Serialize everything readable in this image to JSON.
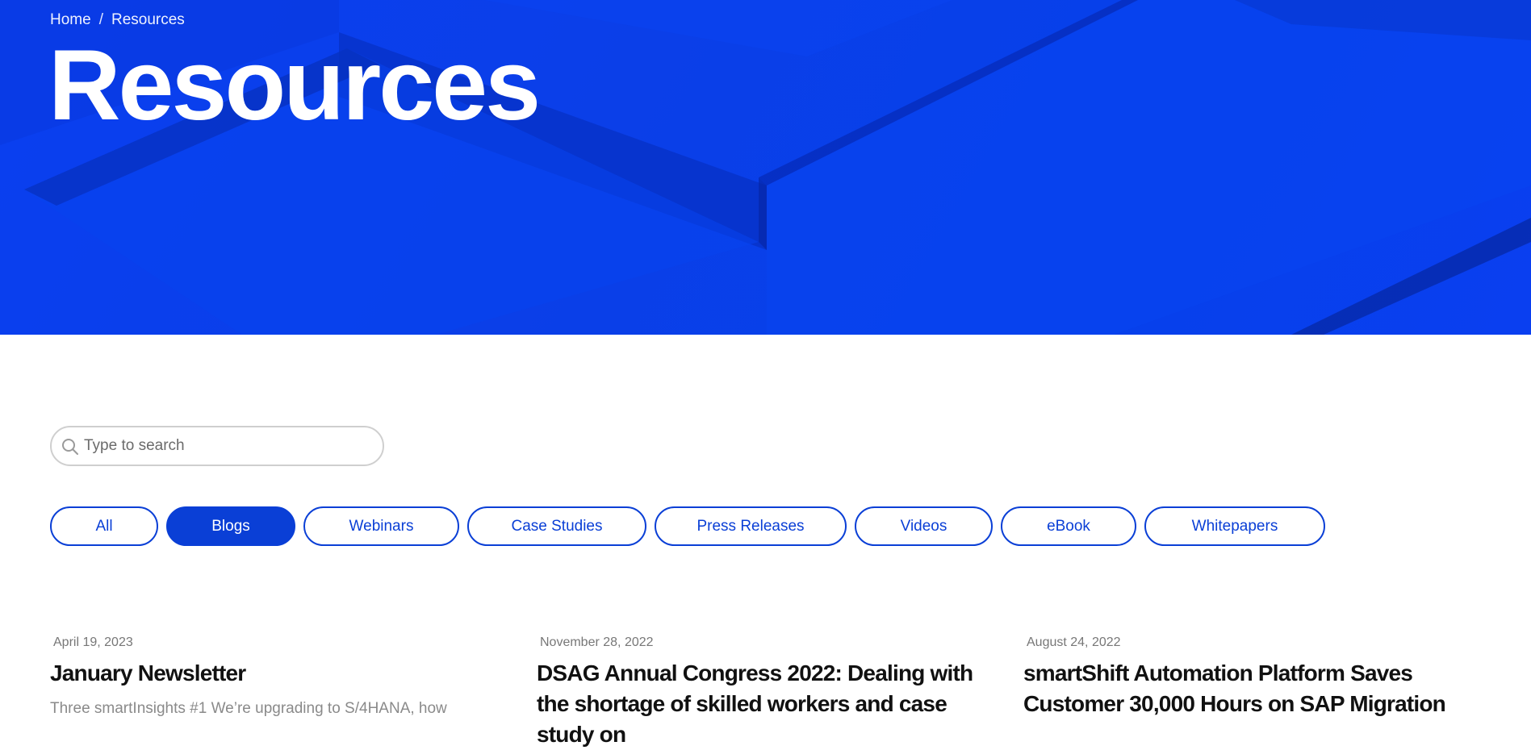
{
  "breadcrumb": {
    "home": "Home",
    "separator": "/",
    "current": "Resources"
  },
  "hero": {
    "title": "Resources",
    "color": "#0a3ff0"
  },
  "search": {
    "placeholder": "Type to search",
    "value": ""
  },
  "filters": [
    {
      "label": "All",
      "active": false
    },
    {
      "label": "Blogs",
      "active": true
    },
    {
      "label": "Webinars",
      "active": false
    },
    {
      "label": "Case Studies",
      "active": false
    },
    {
      "label": "Press Releases",
      "active": false
    },
    {
      "label": "Videos",
      "active": false
    },
    {
      "label": "eBook",
      "active": false
    },
    {
      "label": "Whitepapers",
      "active": false
    }
  ],
  "accent": "#0a3fd6",
  "posts": [
    {
      "date": "April 19, 2023",
      "title": "January Newsletter",
      "excerpt": "Three smartInsights #1 We’re upgrading to S/4HANA, how"
    },
    {
      "date": "November 28, 2022",
      "title": "DSAG Annual Congress 2022: Dealing with the shortage of skilled workers and case study on",
      "excerpt": ""
    },
    {
      "date": "August 24, 2022",
      "title": "smartShift Automation Platform Saves Customer 30,000 Hours on SAP Migration",
      "excerpt": ""
    }
  ]
}
